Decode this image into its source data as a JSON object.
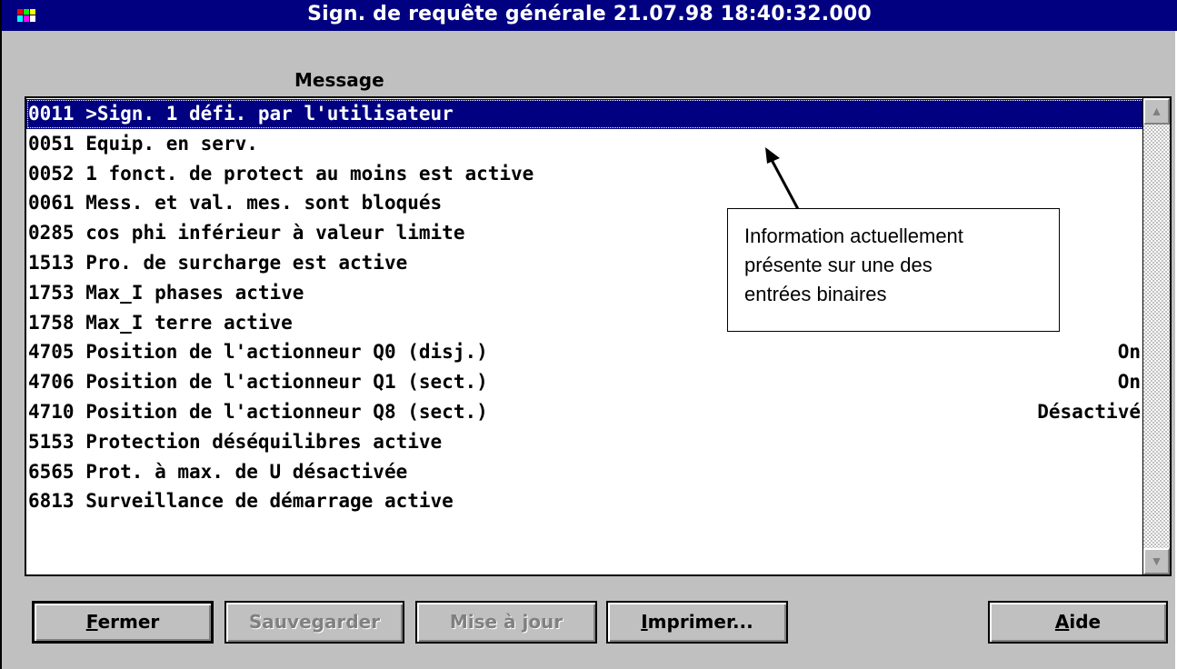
{
  "window": {
    "title": "Sign. de requête générale 21.07.98 18:40:32.000",
    "icon": "app-icon"
  },
  "list": {
    "column_header": "Message",
    "rows": [
      {
        "code": "0011",
        "text": ">Sign. 1 défi. par l'utilisateur",
        "value": "",
        "selected": true
      },
      {
        "code": "0051",
        "text": "Equip. en serv.",
        "value": ""
      },
      {
        "code": "0052",
        "text": "1 fonct. de protect au moins est active",
        "value": ""
      },
      {
        "code": "0061",
        "text": "Mess. et val. mes. sont bloqués",
        "value": ""
      },
      {
        "code": "0285",
        "text": "cos phi inférieur à valeur limite",
        "value": ""
      },
      {
        "code": "1513",
        "text": "Pro. de surcharge est active",
        "value": ""
      },
      {
        "code": "1753",
        "text": "Max_I phases active",
        "value": ""
      },
      {
        "code": "1758",
        "text": "Max_I terre active",
        "value": ""
      },
      {
        "code": "4705",
        "text": "Position de l'actionneur Q0 (disj.)",
        "value": "On"
      },
      {
        "code": "4706",
        "text": "Position de l'actionneur Q1 (sect.)",
        "value": "On"
      },
      {
        "code": "4710",
        "text": "Position de l'actionneur Q8 (sect.)",
        "value": "Désactivé"
      },
      {
        "code": "5153",
        "text": "Protection déséquilibres active",
        "value": ""
      },
      {
        "code": "6565",
        "text": "Prot. à max. de U désactivée",
        "value": ""
      },
      {
        "code": "6813",
        "text": "Surveillance de démarrage active",
        "value": ""
      }
    ]
  },
  "annotation": {
    "lines": [
      "Information actuellement",
      "présente sur une des",
      "entrées binaires"
    ]
  },
  "buttons": {
    "close": {
      "mnemonic": "F",
      "rest": "ermer"
    },
    "save": {
      "label": "Sauvegarder"
    },
    "update": {
      "label": "Mise à jour"
    },
    "print": {
      "mnemonic": "I",
      "rest": "mprimer..."
    },
    "help": {
      "mnemonic": "A",
      "rest": "ide"
    }
  },
  "colors": {
    "titlebar": "#000080",
    "dialog_bg": "#c0c0c0",
    "selection": "#000080"
  }
}
